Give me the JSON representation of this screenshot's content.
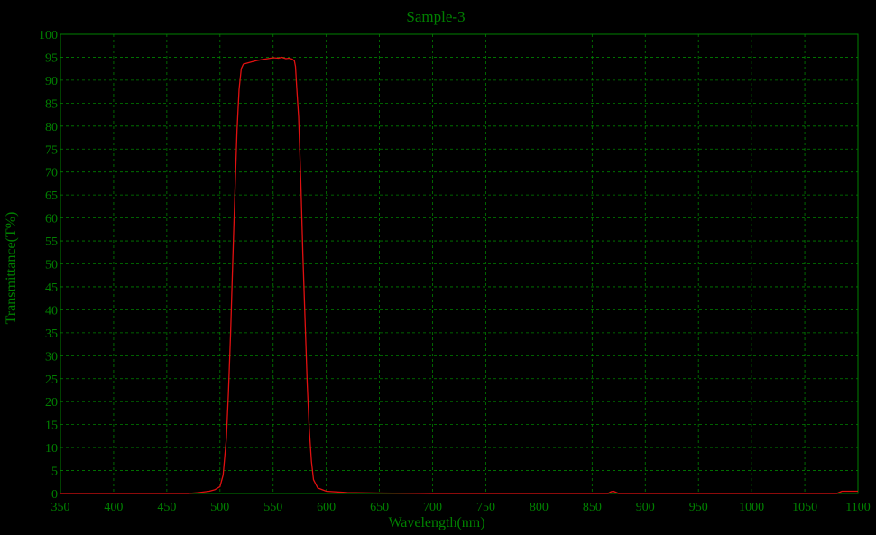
{
  "chart_data": {
    "type": "line",
    "title": "Sample-3",
    "xlabel": "Wavelength(nm)",
    "ylabel": "Transmittance(T%)",
    "xlim": [
      350,
      1100
    ],
    "ylim": [
      0,
      100
    ],
    "xticks": [
      350,
      400,
      450,
      500,
      550,
      600,
      650,
      700,
      750,
      800,
      850,
      900,
      950,
      1000,
      1050,
      1100
    ],
    "yticks": [
      0,
      5,
      10,
      15,
      20,
      25,
      30,
      35,
      40,
      45,
      50,
      55,
      60,
      65,
      70,
      75,
      80,
      85,
      90,
      95,
      100
    ],
    "grid": true,
    "legend": "none",
    "colors": {
      "background": "#000000",
      "axis": "#008000",
      "grid": "#008000",
      "text": "#008000",
      "line": "#e01010"
    },
    "series": [
      {
        "x": [
          350,
          400,
          450,
          470,
          480,
          490,
          495,
          500,
          503,
          506,
          508,
          510,
          512,
          514,
          516,
          518,
          520,
          522,
          525,
          530,
          535,
          540,
          545,
          550,
          555,
          558,
          562,
          565,
          568,
          570,
          571,
          572,
          574,
          576,
          578,
          580,
          582,
          584,
          586,
          588,
          592,
          600,
          620,
          650,
          700,
          800,
          865,
          868,
          870,
          872,
          875,
          900,
          1000,
          1080,
          1085,
          1100
        ],
        "y": [
          0,
          0,
          0,
          0,
          0.2,
          0.5,
          0.8,
          1.5,
          4,
          12,
          22,
          35,
          50,
          65,
          79,
          88,
          92.5,
          93.5,
          93.7,
          94,
          94.3,
          94.5,
          94.7,
          94.9,
          94.8,
          95,
          94.7,
          94.8,
          94.6,
          94.2,
          93,
          89,
          82,
          68,
          52,
          38,
          24,
          14,
          7,
          3,
          1.2,
          0.5,
          0.2,
          0.1,
          0,
          0,
          0,
          0.4,
          0.5,
          0.3,
          0,
          0,
          0,
          0,
          0.5,
          0.5
        ]
      }
    ]
  }
}
